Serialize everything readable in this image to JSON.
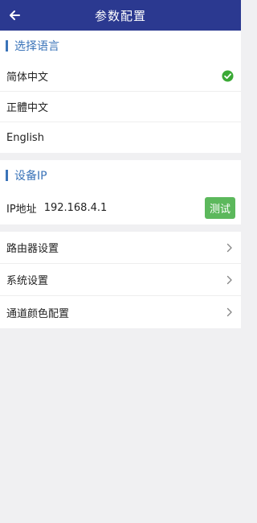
{
  "app_bar": {
    "title": "参数配置",
    "back_icon": "arrow-left-icon"
  },
  "language_section": {
    "title": "选择语言",
    "options": [
      {
        "label": "简体中文",
        "selected": true
      },
      {
        "label": "正體中文",
        "selected": false
      },
      {
        "label": "English",
        "selected": false
      }
    ],
    "check_icon": "check-circle-icon"
  },
  "device_ip_section": {
    "title": "设备IP",
    "ip_label": "IP地址",
    "ip_value": "192.168.4.1",
    "test_button_label": "测试"
  },
  "settings_menu": {
    "items": [
      {
        "label": "路由器设置"
      },
      {
        "label": "系统设置"
      },
      {
        "label": "通道颜色配置"
      }
    ],
    "chevron_icon": "chevron-right-icon"
  },
  "colors": {
    "app_bar_bg": "#2b3990",
    "accent": "#3a73b8",
    "check_green": "#3aa935",
    "test_button_bg": "#5cb85c",
    "page_bg": "#f0f0f2"
  }
}
